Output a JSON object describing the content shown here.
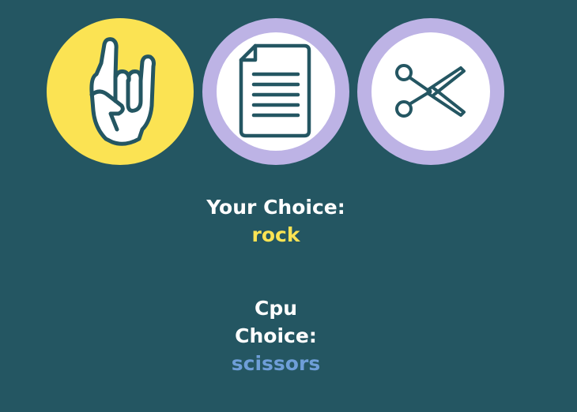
{
  "choices": [
    {
      "name": "rock",
      "icon": "rock-hand-icon",
      "selected": true
    },
    {
      "name": "paper",
      "icon": "paper-document-icon",
      "selected": false
    },
    {
      "name": "scissors",
      "icon": "scissors-icon",
      "selected": false
    }
  ],
  "result": {
    "your_label": "Your Choice:",
    "your_value": "rock",
    "cpu_label": "Cpu Choice:",
    "cpu_value": "scissors"
  },
  "colors": {
    "background": "#245662",
    "selected_fill": "#fbe353",
    "unselected_ring": "#bdb3e5",
    "icon_stroke": "#245662",
    "your_value_color": "#fbe353",
    "cpu_value_color": "#6e9ed8"
  }
}
